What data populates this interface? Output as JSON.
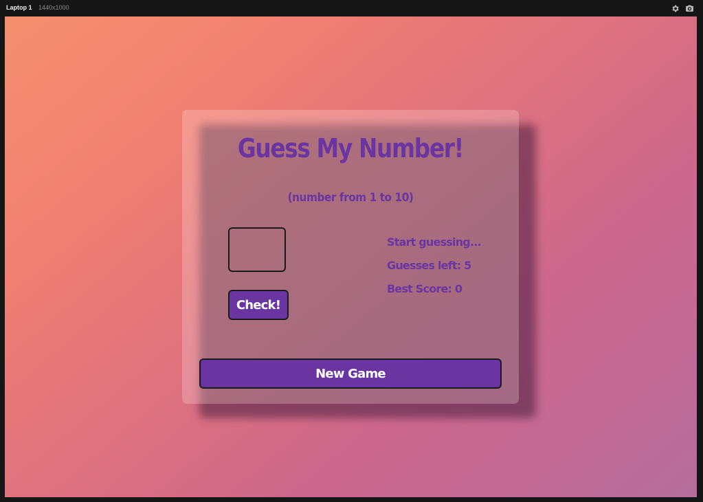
{
  "toolbar": {
    "device_name": "Laptop 1",
    "device_size": "1440x1000",
    "settings_icon": "gear-icon",
    "screenshot_icon": "camera-icon"
  },
  "game": {
    "title": "Guess My Number!",
    "subtitle": "(number from 1 to 10)",
    "guess_input_value": "",
    "check_label": "Check!",
    "message": "Start guessing...",
    "guesses_left_label": "Guesses left: ",
    "guesses_left": "5",
    "best_score_label": "Best Score: ",
    "best_score": "0",
    "new_game_label": "New Game"
  },
  "colors": {
    "accent": "#6a35a0",
    "button_text": "#ffffff",
    "border": "#1a1a1a",
    "background_start": "#f5906f",
    "background_end": "#b46e9c"
  }
}
